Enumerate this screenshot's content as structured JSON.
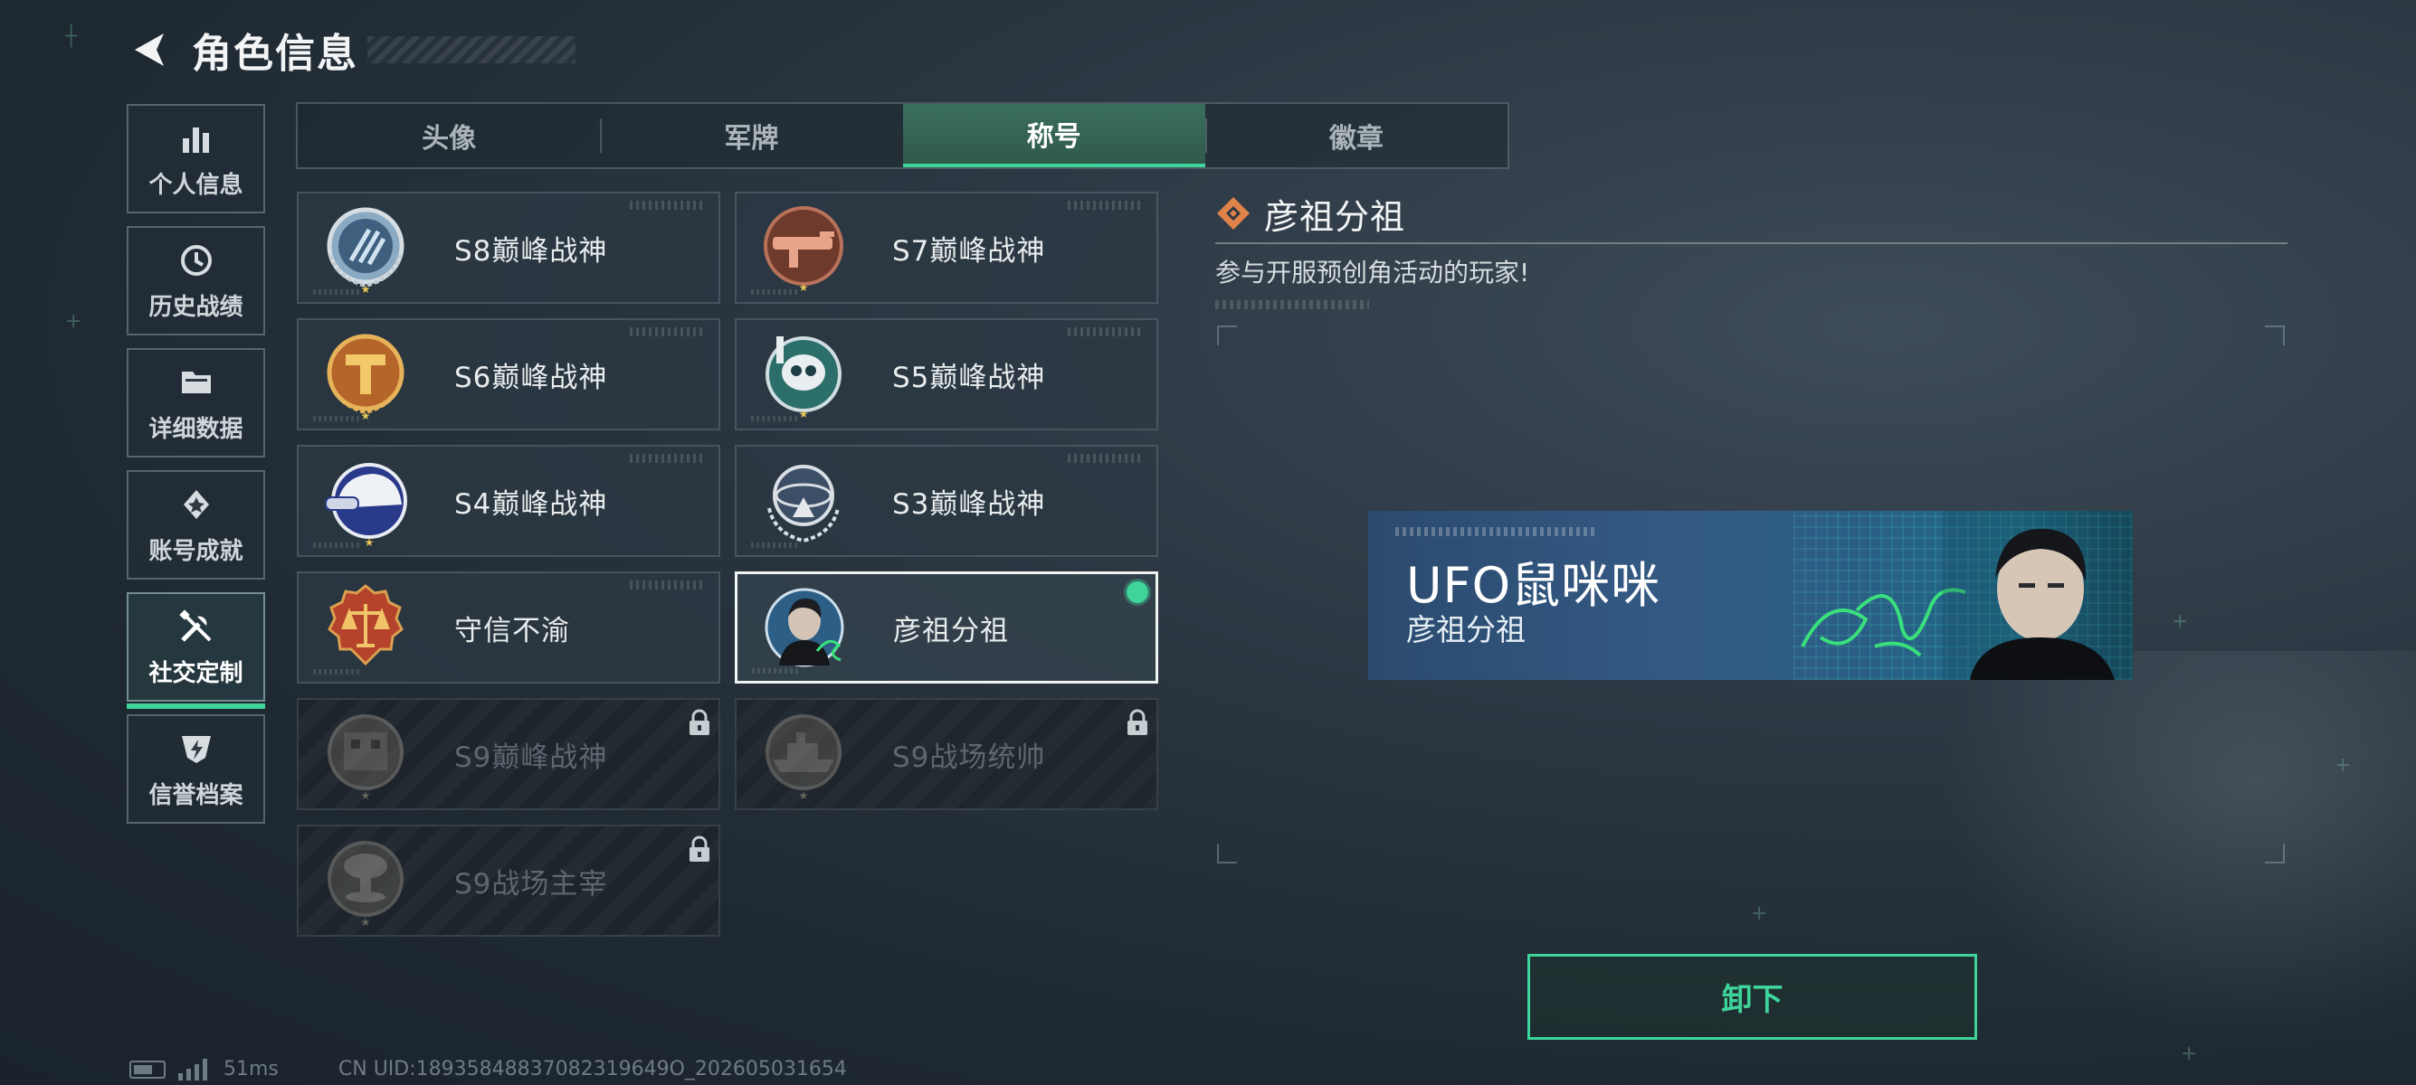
{
  "header": {
    "title": "角色信息"
  },
  "sidenav": [
    {
      "label": "个人信息",
      "icon": "bar-chart-icon",
      "active": false
    },
    {
      "label": "历史战绩",
      "icon": "history-icon",
      "active": false
    },
    {
      "label": "详细数据",
      "icon": "folder-icon",
      "active": false
    },
    {
      "label": "账号成就",
      "icon": "achievement-icon",
      "active": false
    },
    {
      "label": "社交定制",
      "icon": "tools-icon",
      "active": true
    },
    {
      "label": "信誉档案",
      "icon": "credit-shield-icon",
      "active": false
    }
  ],
  "tabs": [
    {
      "label": "头像",
      "active": false
    },
    {
      "label": "军牌",
      "active": false
    },
    {
      "label": "称号",
      "active": true
    },
    {
      "label": "徽章",
      "active": false
    }
  ],
  "titles": [
    {
      "name": "S8巅峰战神",
      "badge": "s8-emblem-icon",
      "state": "unlocked"
    },
    {
      "name": "S7巅峰战神",
      "badge": "s7-emblem-icon",
      "state": "unlocked"
    },
    {
      "name": "S6巅峰战神",
      "badge": "s6-emblem-icon",
      "state": "unlocked"
    },
    {
      "name": "S5巅峰战神",
      "badge": "s5-emblem-icon",
      "state": "unlocked"
    },
    {
      "name": "S4巅峰战神",
      "badge": "s4-emblem-icon",
      "state": "unlocked"
    },
    {
      "name": "S3巅峰战神",
      "badge": "s3-emblem-icon",
      "state": "unlocked"
    },
    {
      "name": "守信不渝",
      "badge": "scales-emblem-icon",
      "state": "unlocked"
    },
    {
      "name": "彦祖分祖",
      "badge": "portrait-emblem-icon",
      "state": "equipped"
    },
    {
      "name": "S9巅峰战神",
      "badge": "s9-emblem-icon",
      "state": "locked"
    },
    {
      "name": "S9战场统帅",
      "badge": "warship-emblem-icon",
      "state": "locked"
    },
    {
      "name": "S9战场主宰",
      "badge": "mushroom-cloud-emblem-icon",
      "state": "locked"
    }
  ],
  "detail": {
    "title": "彦祖分祖",
    "description": "参与开服预创角活动的玩家!"
  },
  "nameplate": {
    "player_name": "UFO鼠咪咪",
    "title": "彦祖分祖"
  },
  "actions": {
    "unequip_label": "卸下"
  },
  "footer": {
    "ping": "51ms",
    "uid": "CN UID:18935848837082319649O_202605031654"
  },
  "colors": {
    "accent": "#3ed49a",
    "background": "#25313b",
    "title_icon": "#e0834a"
  }
}
